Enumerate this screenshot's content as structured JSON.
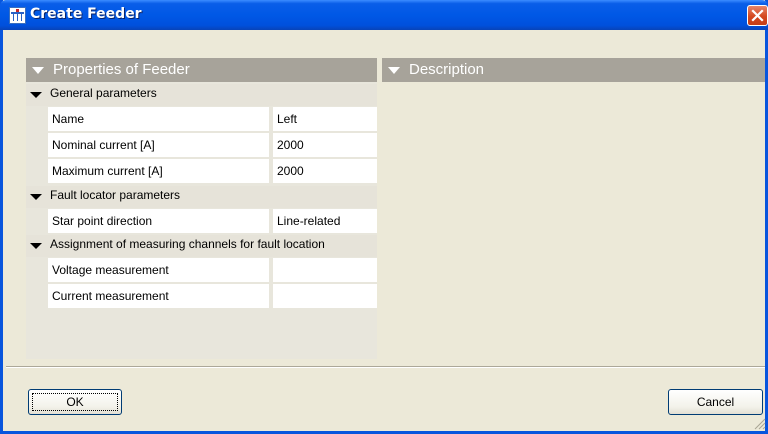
{
  "window": {
    "title": "Create Feeder",
    "icon": "feeder-app-icon",
    "close_icon": "close-icon"
  },
  "properties_pane": {
    "header": "Properties of Feeder",
    "groups": [
      {
        "label": "General parameters",
        "rows": [
          {
            "name": "Name",
            "value": "Left"
          },
          {
            "name": "Nominal current [A]",
            "value": "2000"
          },
          {
            "name": "Maximum current [A]",
            "value": "2000"
          }
        ]
      },
      {
        "label": "Fault locator parameters",
        "rows": [
          {
            "name": "Star point direction",
            "value": "Line-related"
          }
        ]
      },
      {
        "label": "Assignment of measuring channels for fault location",
        "rows": [
          {
            "name": "Voltage measurement",
            "value": ""
          },
          {
            "name": "Current measurement",
            "value": ""
          }
        ]
      }
    ]
  },
  "description_pane": {
    "header": "Description"
  },
  "buttons": {
    "ok": "OK",
    "cancel": "Cancel"
  },
  "colors": {
    "title_bar": "#0058e6",
    "dialog_bg": "#ece9d8",
    "pane_header": "#a7a39a",
    "close_button": "#d4481f"
  }
}
